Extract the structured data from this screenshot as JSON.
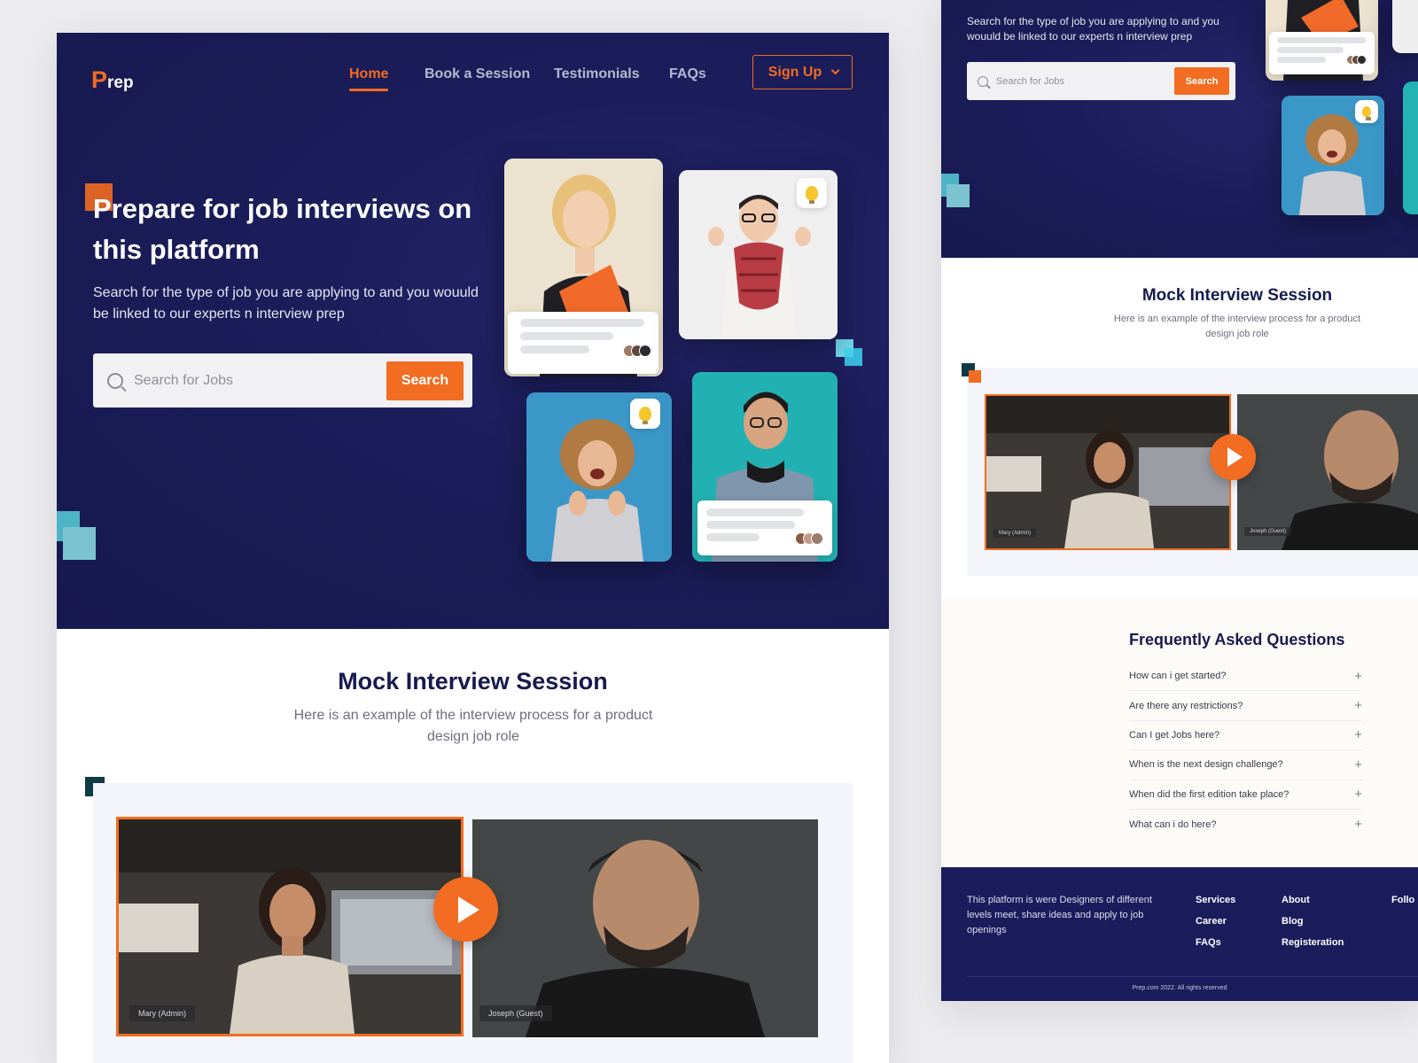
{
  "brand": {
    "logo_p": "P",
    "logo_rest": "rep"
  },
  "nav": {
    "home": "Home",
    "book": "Book a Session",
    "testimonials": "Testimonials",
    "faqs": "FAQs",
    "signup": "Sign Up"
  },
  "hero": {
    "title": "Prepare for job interviews on this platform",
    "subtitle": "Search for the type of job you are applying to and you wouuld be linked to our experts n interview prep",
    "search_placeholder": "Search for Jobs",
    "search_button": "Search"
  },
  "mock": {
    "title": "Mock Interview Session",
    "subtitle": "Here is an example of the interview process for a product design job role",
    "admin_label": "Mary (Admin)",
    "guest_label": "Joseph (Guest)"
  },
  "faq": {
    "title": "Frequently Asked Questions",
    "items": [
      "How can i get started?",
      "Are there any restrictions?",
      "Can I get Jobs here?",
      "When is the next design challenge?",
      "When did the first edition take place?",
      "What can i do here?"
    ],
    "expand_glyph": "+"
  },
  "footer": {
    "description": "This platform is were Designers of different levels meet, share ideas and apply to job openings",
    "col1": [
      "Services",
      "Career",
      "FAQs"
    ],
    "col2": [
      "About",
      "Blog",
      "Registeration"
    ],
    "col3_heading": "Follo",
    "copyright": "Prep.com 2022. All rights reserved"
  },
  "colors": {
    "navy": "#1b1d5a",
    "accent": "#f26c21",
    "teal": "#6fc3cf",
    "dark_square": "#0f3b44"
  }
}
